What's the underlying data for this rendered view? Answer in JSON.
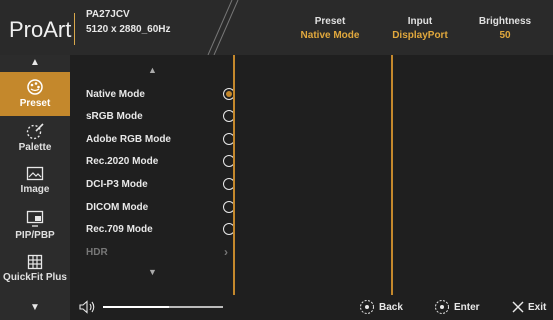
{
  "header": {
    "logo": "ProArt",
    "model": "PA27JCV",
    "resolution": "5120 x 2880_60Hz",
    "status": [
      {
        "label": "Preset",
        "value": "Native Mode"
      },
      {
        "label": "Input",
        "value": "DisplayPort"
      },
      {
        "label": "Brightness",
        "value": "50"
      }
    ],
    "accent": "#e1a83d"
  },
  "sidebar": {
    "up_arrow": "▲",
    "down_arrow": "▼",
    "items": [
      {
        "label": "Preset",
        "icon": "palette-preset-icon",
        "active": true
      },
      {
        "label": "Palette",
        "icon": "palette-icon",
        "active": false
      },
      {
        "label": "Image",
        "icon": "image-icon",
        "active": false
      },
      {
        "label": "PIP/PBP",
        "icon": "pip-icon",
        "active": false
      },
      {
        "label": "QuickFit Plus",
        "icon": "grid-icon",
        "active": false
      }
    ]
  },
  "menu": {
    "up_arrow": "▲",
    "down_arrow": "▼",
    "items": [
      {
        "label": "Native Mode",
        "selected": true
      },
      {
        "label": "sRGB Mode",
        "selected": false
      },
      {
        "label": "Adobe RGB Mode",
        "selected": false
      },
      {
        "label": "Rec.2020 Mode",
        "selected": false
      },
      {
        "label": "DCI-P3 Mode",
        "selected": false
      },
      {
        "label": "DICOM Mode",
        "selected": false
      },
      {
        "label": "Rec.709 Mode",
        "selected": false
      },
      {
        "label": "HDR",
        "selected": false,
        "disabled": true
      }
    ]
  },
  "footer": {
    "volume_icon": "speaker-icon",
    "volume_level": 0.55,
    "back": "Back",
    "enter": "Enter",
    "exit": "Exit"
  }
}
